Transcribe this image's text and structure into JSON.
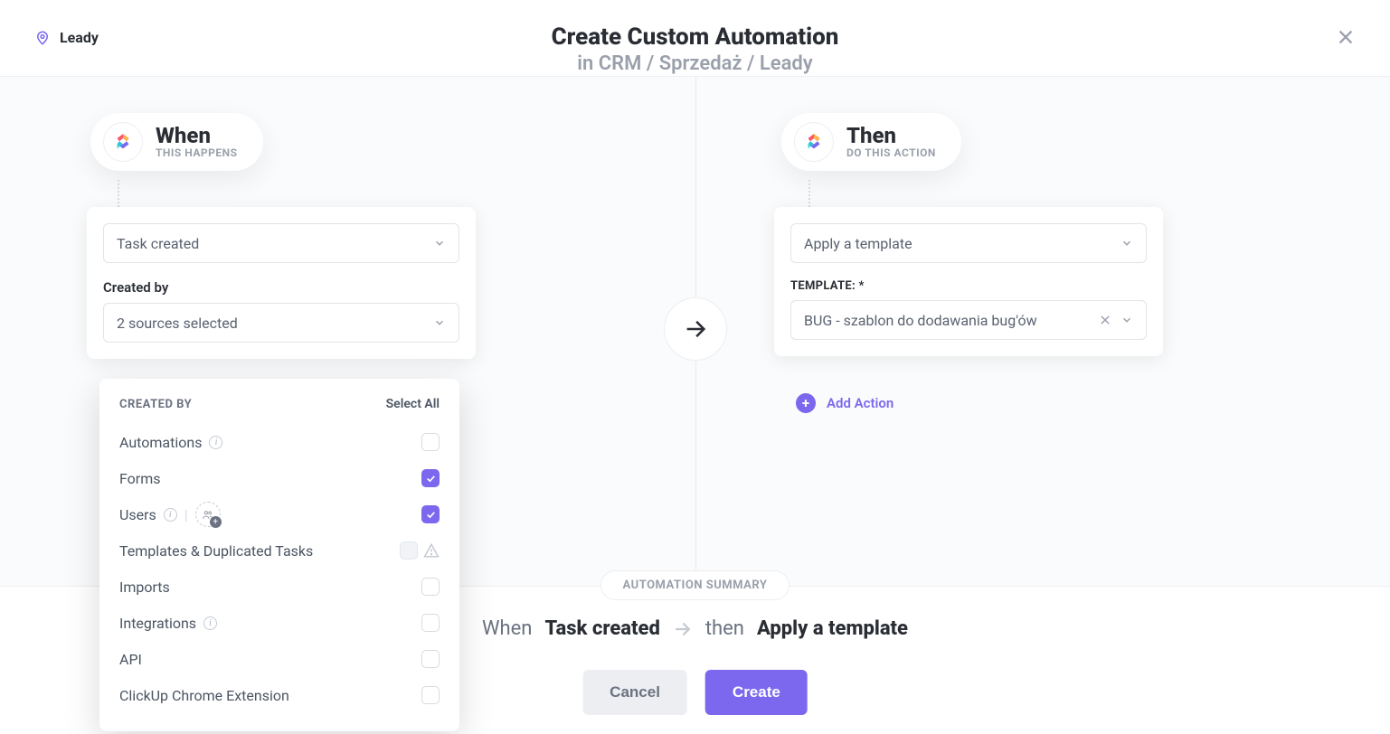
{
  "header": {
    "location": "Leady",
    "title": "Create Custom Automation",
    "subtitle": "in CRM / Sprzedaż / Leady"
  },
  "trigger": {
    "pill_title": "When",
    "pill_subtitle": "THIS HAPPENS",
    "select_value": "Task created",
    "created_by_label": "Created by",
    "created_by_value": "2 sources selected"
  },
  "action": {
    "pill_title": "Then",
    "pill_subtitle": "DO THIS ACTION",
    "select_value": "Apply a template",
    "template_label": "TEMPLATE: *",
    "template_value": "BUG - szablon do dodawania bug'ów",
    "add_action_label": "Add Action"
  },
  "popover": {
    "title": "CREATED BY",
    "select_all": "Select All",
    "options": [
      {
        "label": "Automations",
        "info": true,
        "checked": false,
        "disabled": false,
        "users_badge": false,
        "warn": false
      },
      {
        "label": "Forms",
        "info": false,
        "checked": true,
        "disabled": false,
        "users_badge": false,
        "warn": false
      },
      {
        "label": "Users",
        "info": true,
        "checked": true,
        "disabled": false,
        "users_badge": true,
        "warn": false
      },
      {
        "label": "Templates & Duplicated Tasks",
        "info": false,
        "checked": false,
        "disabled": true,
        "users_badge": false,
        "warn": true
      },
      {
        "label": "Imports",
        "info": false,
        "checked": false,
        "disabled": false,
        "users_badge": false,
        "warn": false
      },
      {
        "label": "Integrations",
        "info": true,
        "checked": false,
        "disabled": false,
        "users_badge": false,
        "warn": false
      },
      {
        "label": "API",
        "info": false,
        "checked": false,
        "disabled": false,
        "users_badge": false,
        "warn": false
      },
      {
        "label": "ClickUp Chrome Extension",
        "info": false,
        "checked": false,
        "disabled": false,
        "users_badge": false,
        "warn": false
      }
    ]
  },
  "summary": {
    "chip": "AUTOMATION SUMMARY",
    "when_prefix": "When",
    "when_value": "Task created",
    "then_prefix": "then",
    "then_value": "Apply a template"
  },
  "buttons": {
    "cancel": "Cancel",
    "create": "Create"
  }
}
